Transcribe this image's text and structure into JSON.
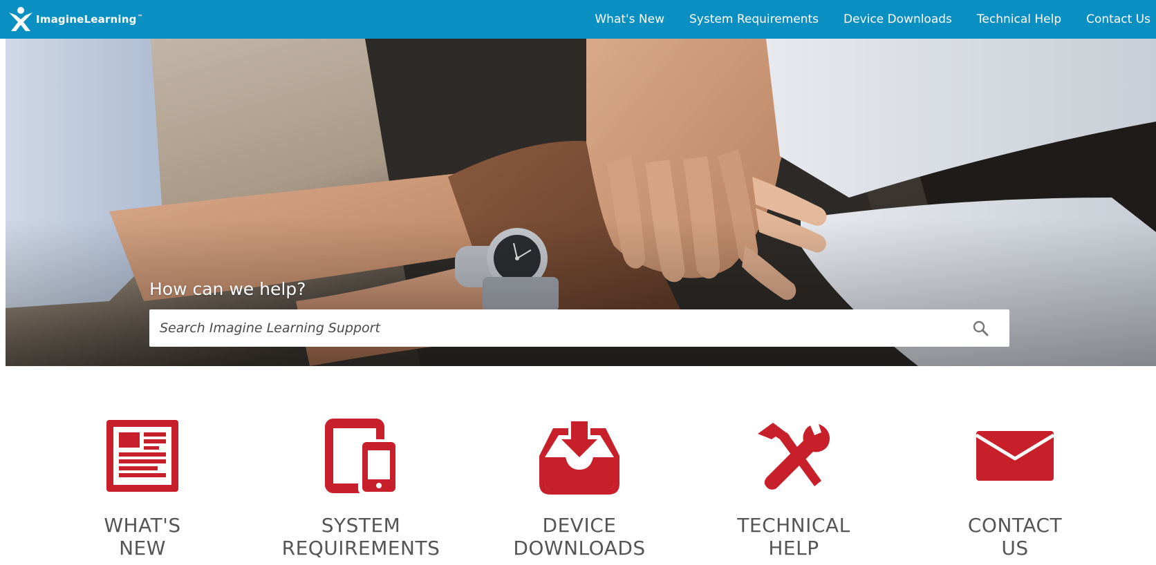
{
  "header": {
    "logo_text": "ImagineLearning",
    "logo_tm": "™",
    "bar_color": "#0a8fc2",
    "nav": [
      {
        "label": "What's New"
      },
      {
        "label": "System Requirements"
      },
      {
        "label": "Device Downloads"
      },
      {
        "label": "Technical Help"
      },
      {
        "label": "Contact Us"
      }
    ]
  },
  "hero": {
    "heading": "How can we help?",
    "search": {
      "placeholder": "Search Imagine Learning Support",
      "icon": "search-icon"
    }
  },
  "tiles": [
    {
      "line1": "WHAT'S",
      "line2": "NEW",
      "icon": "newspaper-icon"
    },
    {
      "line1": "SYSTEM",
      "line2": "REQUIREMENTS",
      "icon": "devices-icon"
    },
    {
      "line1": "DEVICE",
      "line2": "DOWNLOADS",
      "icon": "download-tray-icon"
    },
    {
      "line1": "TECHNICAL",
      "line2": "HELP",
      "icon": "hammer-wrench-icon"
    },
    {
      "line1": "CONTACT",
      "line2": "US",
      "icon": "envelope-icon"
    }
  ],
  "colors": {
    "icon_red": "#c8202a",
    "label_gray": "#555555"
  }
}
